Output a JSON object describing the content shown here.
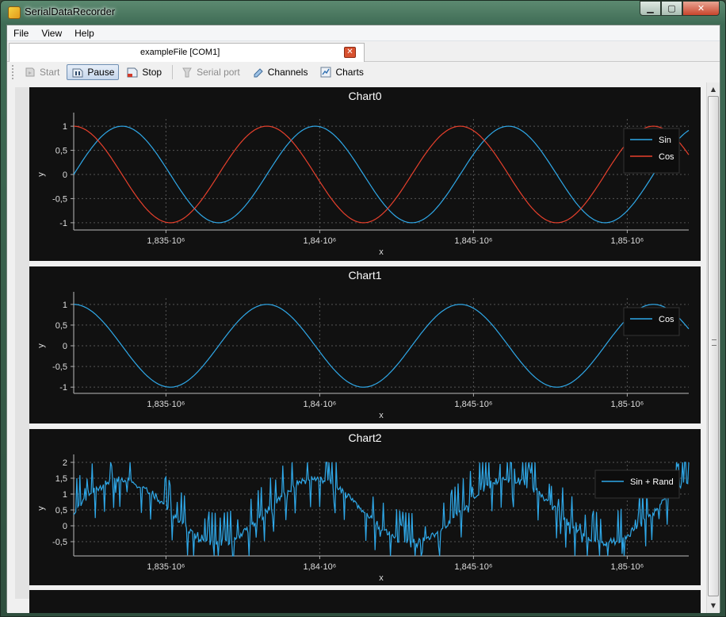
{
  "window": {
    "title": "SerialDataRecorder",
    "min_glyph": "▁",
    "max_glyph": "▢",
    "close_glyph": "✕"
  },
  "menu": [
    {
      "label": "File"
    },
    {
      "label": "View"
    },
    {
      "label": "Help"
    }
  ],
  "tabs": [
    {
      "label": "exampleFile [COM1]",
      "close_glyph": "✕"
    }
  ],
  "toolbar": {
    "start": {
      "label": "Start",
      "icon": "start-icon",
      "enabled": false
    },
    "pause": {
      "label": "Pause",
      "icon": "pause-icon",
      "enabled": true,
      "active": true
    },
    "stop": {
      "label": "Stop",
      "icon": "stop-icon",
      "enabled": true
    },
    "serial": {
      "label": "Serial port",
      "icon": "serial-port-icon",
      "enabled": false
    },
    "channels": {
      "label": "Channels",
      "icon": "channels-icon",
      "enabled": true
    },
    "charts": {
      "label": "Charts",
      "icon": "charts-icon",
      "enabled": true
    }
  },
  "colors": {
    "sin": "#2fa8e8",
    "cos": "#e8402c",
    "background": "#111111",
    "grid": "#555555"
  },
  "chart_data": [
    {
      "type": "line",
      "title": "Chart0",
      "xlabel": "x",
      "ylabel": "y",
      "xlim": [
        1832000,
        1852000
      ],
      "ylim": [
        -1.15,
        1.15
      ],
      "xticks": [
        1835000,
        1840000,
        1845000,
        1850000
      ],
      "xtick_labels": [
        "1,835·10⁶",
        "1,84·10⁶",
        "1,845·10⁶",
        "1,85·10⁶"
      ],
      "yticks": [
        1,
        0.5,
        0,
        -0.5,
        -1
      ],
      "ytick_labels": [
        "1",
        "0,5",
        "0",
        "-0,5",
        "-1"
      ],
      "legend": "top-right",
      "series": [
        {
          "name": "Sin",
          "color": "#2fa8e8",
          "func": "sin",
          "period": 6283,
          "phase_x": 1832000
        },
        {
          "name": "Cos",
          "color": "#e8402c",
          "func": "cos",
          "period": 6283,
          "phase_x": 1832000
        }
      ]
    },
    {
      "type": "line",
      "title": "Chart1",
      "xlabel": "x",
      "ylabel": "y",
      "xlim": [
        1832000,
        1852000
      ],
      "ylim": [
        -1.15,
        1.15
      ],
      "xticks": [
        1835000,
        1840000,
        1845000,
        1850000
      ],
      "xtick_labels": [
        "1,835·10⁶",
        "1,84·10⁶",
        "1,845·10⁶",
        "1,85·10⁶"
      ],
      "yticks": [
        1,
        0.5,
        0,
        -0.5,
        -1
      ],
      "ytick_labels": [
        "1",
        "0,5",
        "0",
        "-0,5",
        "-1"
      ],
      "legend": "top-right",
      "series": [
        {
          "name": "Cos",
          "color": "#2fa8e8",
          "func": "cos",
          "period": 6283,
          "phase_x": 1832000
        }
      ]
    },
    {
      "type": "line",
      "title": "Chart2",
      "xlabel": "x",
      "ylabel": "y",
      "xlim": [
        1832000,
        1852000
      ],
      "ylim": [
        -0.95,
        2.05
      ],
      "xticks": [
        1835000,
        1840000,
        1845000,
        1850000
      ],
      "xtick_labels": [
        "1,835·10⁶",
        "1,84·10⁶",
        "1,845·10⁶",
        "1,85·10⁶"
      ],
      "yticks": [
        2,
        1.5,
        1,
        0.5,
        0,
        -0.5
      ],
      "ytick_labels": [
        "2",
        "1,5",
        "1",
        "0,5",
        "0",
        "-0,5"
      ],
      "legend": "top-right",
      "series": [
        {
          "name": "Sin + Rand",
          "color": "#2fa8e8",
          "func": "sinrand",
          "period": 6283,
          "phase_x": 1832000
        }
      ]
    }
  ]
}
